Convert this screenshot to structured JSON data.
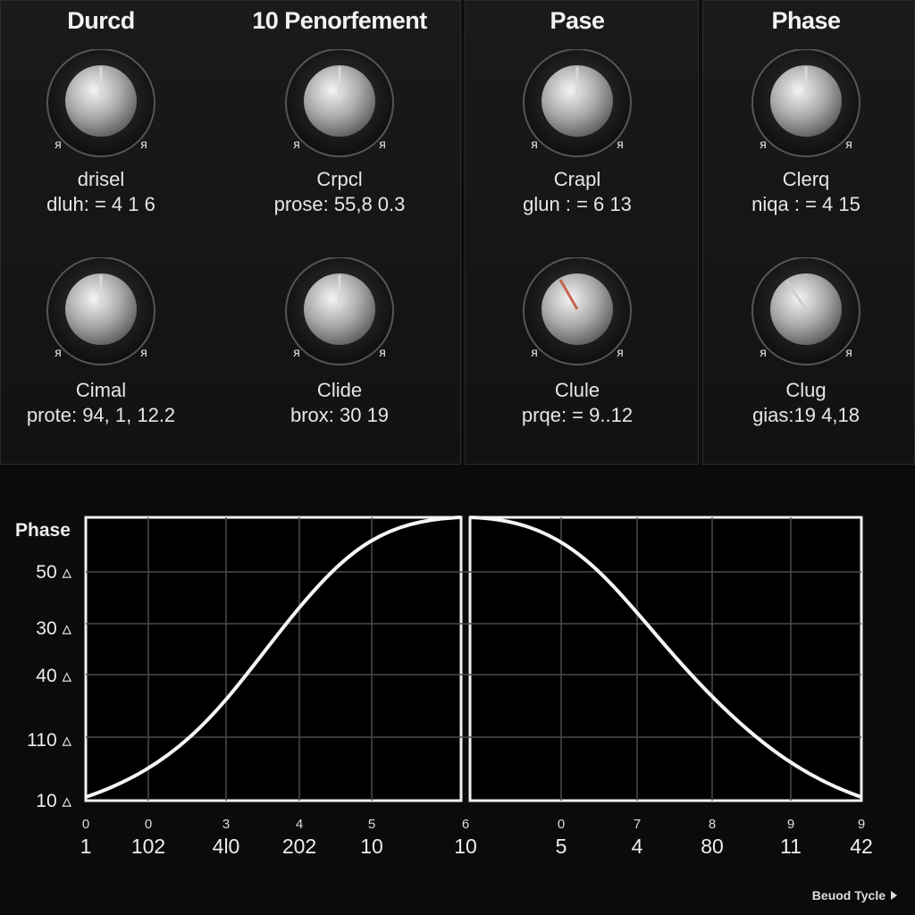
{
  "sections": [
    "Durcd",
    "10 Penorfement",
    "Pase",
    "Phase"
  ],
  "knobs": [
    {
      "label": "drisel",
      "value": "dluh: = 4 1 6",
      "pointer_color": "#d9d9d9"
    },
    {
      "label": "Crpcl",
      "value": "prose: 55,8 0.3",
      "pointer_color": "#d9d9d9"
    },
    {
      "label": "Crapl",
      "value": "glun : = 6 13",
      "pointer_color": "#d9d9d9"
    },
    {
      "label": "Clerq",
      "value": "niqa : = 4 15",
      "pointer_color": "#d9d9d9"
    },
    {
      "label": "Cimal",
      "value": "prote: 94, 1, 12.2",
      "pointer_color": "#d9d9d9"
    },
    {
      "label": "Clide",
      "value": "brox: 30 19",
      "pointer_color": "#d9d9d9"
    },
    {
      "label": "Clule",
      "value": "prqe: = 9..12",
      "pointer_color": "#c8644f"
    },
    {
      "label": "Clug",
      "value": "gias:19 4,18",
      "pointer_color": "#cfcfcf"
    }
  ],
  "knob_marks": [
    "ᴙ",
    "ᴙ"
  ],
  "graph": {
    "title": "Phase",
    "y_labels": [
      "50 ▵",
      "30 ▵",
      "40 ▵",
      "110 ▵",
      "10 ▵"
    ],
    "x_top": [
      "0",
      "0",
      "3",
      "4",
      "5",
      "6",
      "0",
      "7",
      "8",
      "9",
      "9"
    ],
    "x_bottom": [
      "1",
      "102",
      "4l0",
      "202",
      "10",
      "10",
      "5",
      "4",
      "80",
      "11",
      "42"
    ]
  },
  "footer": {
    "label": "Beuod Tycle"
  }
}
